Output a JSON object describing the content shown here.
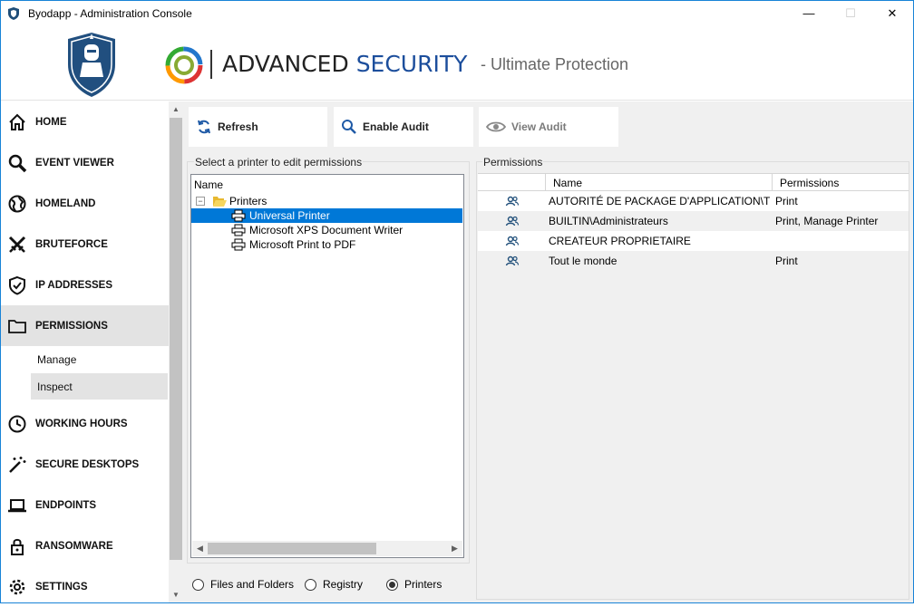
{
  "window": {
    "title": "Byodapp - Administration Console",
    "minimize": "—",
    "maximize": "☐",
    "close": "✕"
  },
  "header": {
    "brand_part1": "ADVANCED",
    "brand_part2": "SECURITY",
    "tagline": "- Ultimate Protection"
  },
  "sidebar": {
    "items": [
      {
        "label": "HOME",
        "icon": "home-icon"
      },
      {
        "label": "EVENT VIEWER",
        "icon": "search-icon"
      },
      {
        "label": "HOMELAND",
        "icon": "globe-icon"
      },
      {
        "label": "BRUTEFORCE",
        "icon": "crossed-swords-icon"
      },
      {
        "label": "IP ADDRESSES",
        "icon": "shield-check-icon"
      },
      {
        "label": "PERMISSIONS",
        "icon": "folder-icon"
      },
      {
        "label": "WORKING HOURS",
        "icon": "clock-icon"
      },
      {
        "label": "SECURE DESKTOPS",
        "icon": "magic-wand-icon"
      },
      {
        "label": "ENDPOINTS",
        "icon": "laptop-icon"
      },
      {
        "label": "RANSOMWARE",
        "icon": "lock-icon"
      },
      {
        "label": "SETTINGS",
        "icon": "gear-icon"
      }
    ],
    "sub_items": [
      {
        "label": "Manage"
      },
      {
        "label": "Inspect"
      }
    ],
    "active": "PERMISSIONS",
    "active_sub": "Inspect"
  },
  "toolbar": {
    "refresh": "Refresh",
    "enable_audit": "Enable Audit",
    "view_audit": "View Audit"
  },
  "tree": {
    "group_label": "Select a printer to edit permissions",
    "column": "Name",
    "root": "Printers",
    "root_toggle": "−",
    "children": [
      "Universal Printer",
      "Microsoft XPS Document Writer",
      "Microsoft Print to PDF"
    ],
    "selected": "Universal Printer"
  },
  "permissions": {
    "group_label": "Permissions",
    "columns": [
      "Name",
      "Permissions"
    ],
    "rows": [
      {
        "name": "AUTORITÉ DE PACKAGE D'APPLICATION\\TOUS L...",
        "perm": "Print"
      },
      {
        "name": "BUILTIN\\Administrateurs",
        "perm": "Print, Manage Printer"
      },
      {
        "name": "CREATEUR PROPRIETAIRE",
        "perm": ""
      },
      {
        "name": "Tout le monde",
        "perm": "Print"
      }
    ]
  },
  "scope": {
    "options": [
      "Files and Folders",
      "Registry",
      "Printers"
    ],
    "selected": "Printers"
  },
  "colors": {
    "accent": "#0078d7",
    "brand_blue": "#1c4e9c",
    "active_nav": "#e3e3e3"
  }
}
